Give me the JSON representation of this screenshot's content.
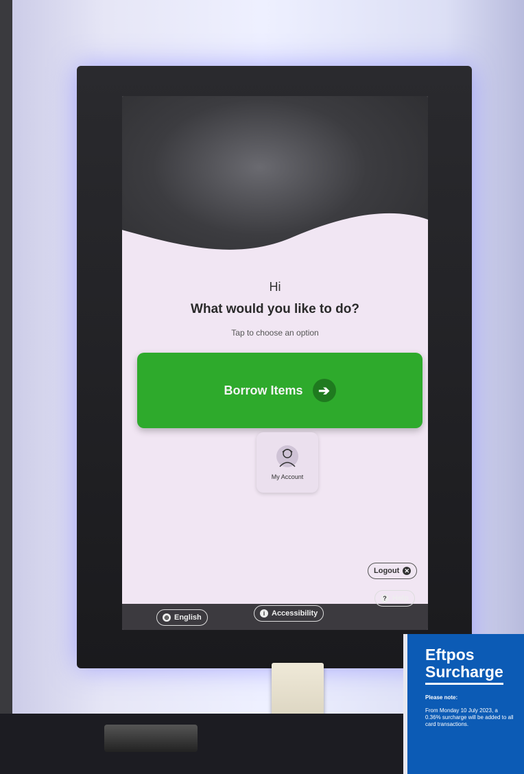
{
  "screen": {
    "greeting": "Hi",
    "question": "What would you like to do?",
    "hint": "Tap to choose an option",
    "borrow_label": "Borrow Items",
    "account_label": "My Account",
    "logout_label": "Logout",
    "help_label": "Help",
    "language_label": "English",
    "accessibility_label": "Accessibility"
  },
  "colors": {
    "primary_green": "#2eaa2c",
    "sign_blue": "#0c5bb5"
  },
  "icons": {
    "arrow": "arrow-right-icon",
    "account": "user-icon",
    "logout": "close-circle-icon",
    "help": "question-icon",
    "language": "globe-icon",
    "accessibility": "info-icon"
  },
  "sign": {
    "title_line1": "Eftpos",
    "title_line2": "Surcharge",
    "note": "Please note:",
    "body": "From Monday 10 July 2023, a 0.36% surcharge will be added to all card transactions."
  }
}
